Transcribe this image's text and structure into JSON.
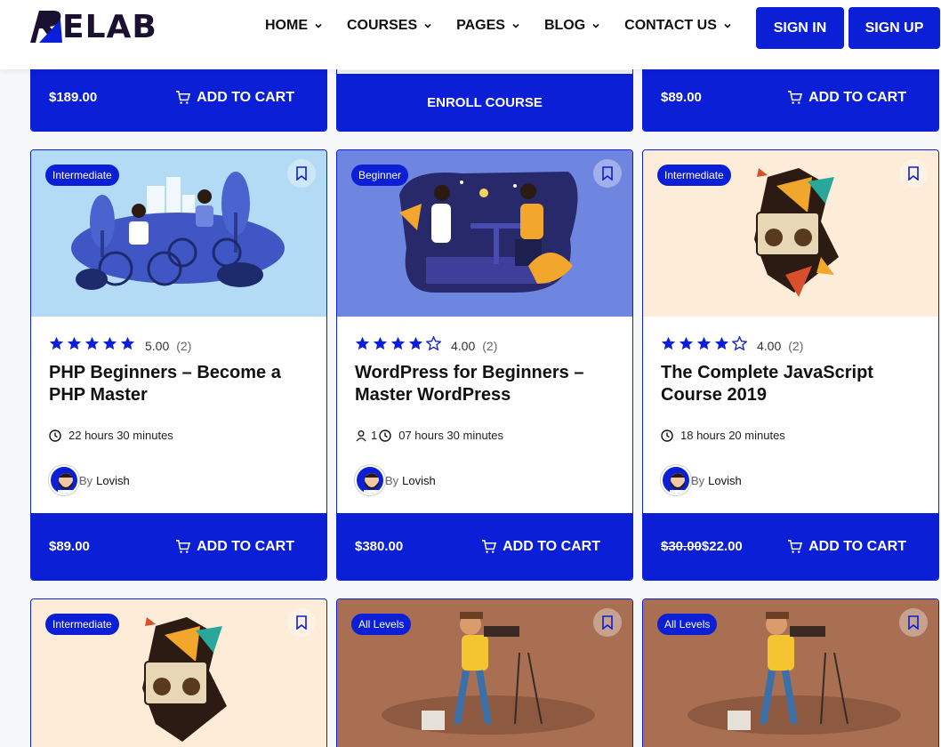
{
  "header": {
    "logo_text": "ELAB",
    "logo_letter": "R",
    "nav": [
      "HOME",
      "COURSES",
      "PAGES",
      "BLOG",
      "CONTACT US"
    ],
    "sign_in": "SIGN IN",
    "sign_up": "SIGN UP"
  },
  "top_row": {
    "left_price": "$189.00",
    "left_action": "ADD TO CART",
    "mid_action": "ENROLL COURSE",
    "right_price": "$89.00",
    "right_action": "ADD TO CART"
  },
  "courses": [
    {
      "level": "Intermediate",
      "rating": "5.00",
      "stars": 5,
      "count": "(2)",
      "title": "PHP Beginners – Become a PHP Master",
      "meta": "22 hours 30 minutes",
      "by": "By",
      "author": "Lovish",
      "price": "$89.00",
      "action": "ADD TO CART",
      "thumb_color": "#b3dbf5"
    },
    {
      "level": "Beginner",
      "rating": "4.00",
      "stars": 4,
      "count": "(2)",
      "title": "WordPress for Beginners – Master WordPress",
      "students": "1",
      "meta": "07 hours 30 minutes",
      "by": "By",
      "author": "Lovish",
      "price": "$380.00",
      "action": "ADD TO CART",
      "thumb_color": "#6f86e0"
    },
    {
      "level": "Intermediate",
      "rating": "4.00",
      "stars": 4,
      "count": "(2)",
      "title": "The Complete JavaScript Course 2019",
      "meta": "18 hours 20 minutes",
      "by": "By",
      "author": "Lovish",
      "old_price": "$30.00",
      "price": "$22.00",
      "action": "ADD TO CART",
      "thumb_color": "#fdecd8"
    }
  ],
  "bottom_row": [
    {
      "level": "Intermediate",
      "thumb_color": "#fdecd8"
    },
    {
      "level": "All Levels",
      "thumb_color": "#a86f52"
    },
    {
      "level": "All Levels",
      "thumb_color": "#a86f52"
    }
  ],
  "colors": {
    "accent": "#0a1fd6",
    "star": "#0a1fd6"
  },
  "icons": [
    "chevron-down-icon",
    "cart-icon",
    "bookmark-icon",
    "star-icon",
    "clock-icon",
    "user-icon"
  ]
}
